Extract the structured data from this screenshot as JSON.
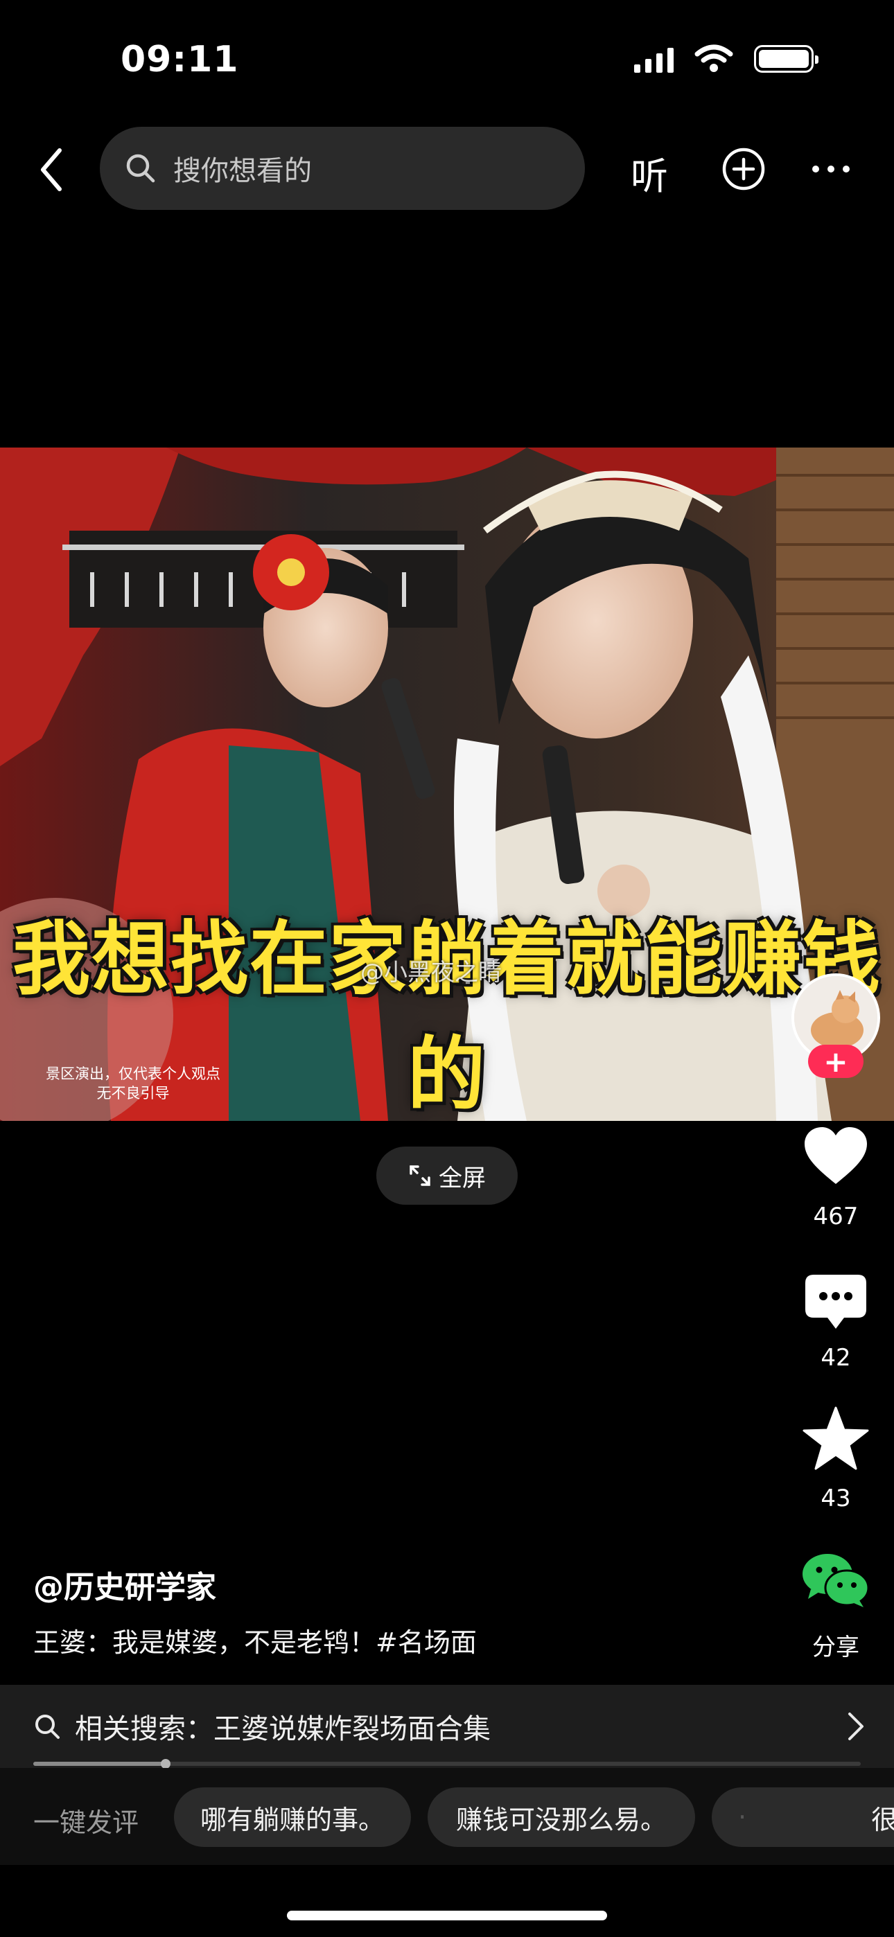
{
  "status_bar": {
    "time": "09:11"
  },
  "nav": {
    "search_placeholder": "搜你想看的",
    "listen_label": "听"
  },
  "video": {
    "subtitle": "我想找在家躺着就能赚钱的",
    "watermark": "@小黑夜之睛",
    "disclaimer_line1": "景区演出，仅代表个人观点",
    "disclaimer_line2": "无不良引导",
    "fullscreen_label": "全屏"
  },
  "rail": {
    "likes": "467",
    "comments": "42",
    "favorites": "43",
    "share_label": "分享"
  },
  "post": {
    "author": "@历史研学家",
    "caption": "王婆：我是媒婆，不是老鸨！#名场面"
  },
  "related": {
    "text": "相关搜索：王婆说媒炸裂场面合集"
  },
  "playback": {
    "progress": 0.16
  },
  "quick_comment": {
    "label": "一键发评",
    "chips": [
      "哪有躺赚的事。",
      "赚钱可没那么易。",
      "·",
      "很"
    ]
  },
  "colors": {
    "accent": "#fe2c55",
    "wechat_green": "#2fc65a",
    "subtitle_yellow": "#ffe437"
  }
}
